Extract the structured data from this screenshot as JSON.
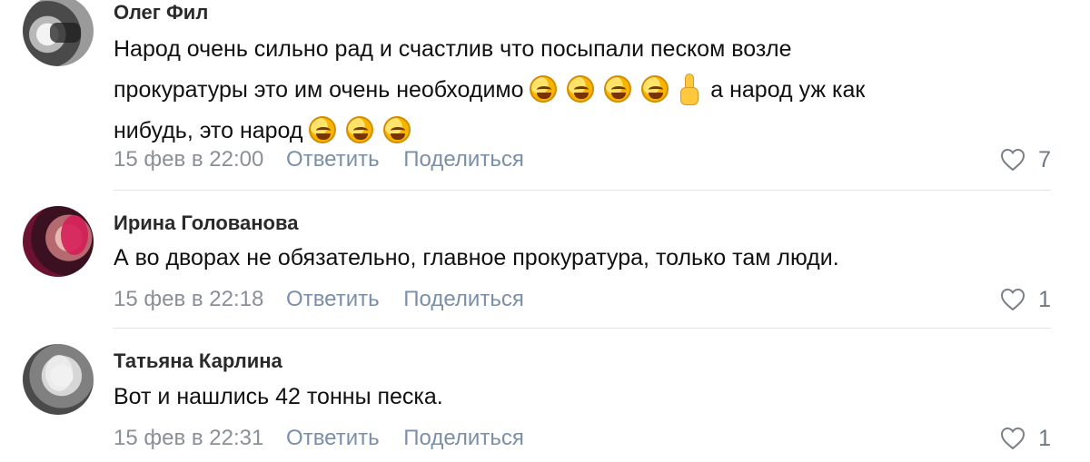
{
  "comments": [
    {
      "author": "Олег Фил",
      "text_parts": {
        "line1": "Народ очень сильно рад и счастлив что посыпали песком возле",
        "line2_start": "прокуратуры это им очень необходимо",
        "line2_end": "а народ уж как",
        "line3_start": "нибудь, это народ"
      },
      "date": "15 фев в 22:00",
      "reply_label": "Ответить",
      "share_label": "Поделиться",
      "likes": "7",
      "icons": {
        "like": "heart-icon",
        "emoji_laugh": "rolling-on-floor-laughing-emoji",
        "emoji_finger": "raised-index-finger-emoji"
      }
    },
    {
      "author": "Ирина Голованова",
      "text": "А во дворах не обязательно, главное прокуратура, только там люди.",
      "date": "15 фев в 22:18",
      "reply_label": "Ответить",
      "share_label": "Поделиться",
      "likes": "1",
      "icons": {
        "like": "heart-icon"
      }
    },
    {
      "author": "Татьяна Карлина",
      "text": "Вот и нашлись 42 тонны песка.",
      "date": "15 фев в 22:31",
      "reply_label": "Ответить",
      "share_label": "Поделиться",
      "likes": "1",
      "icons": {
        "like": "heart-icon"
      }
    }
  ],
  "colors": {
    "author": "#2a2a2a",
    "text": "#111111",
    "meta": "#8a8f98",
    "action": "#7a8fa8",
    "divider": "#dfe3e8"
  }
}
